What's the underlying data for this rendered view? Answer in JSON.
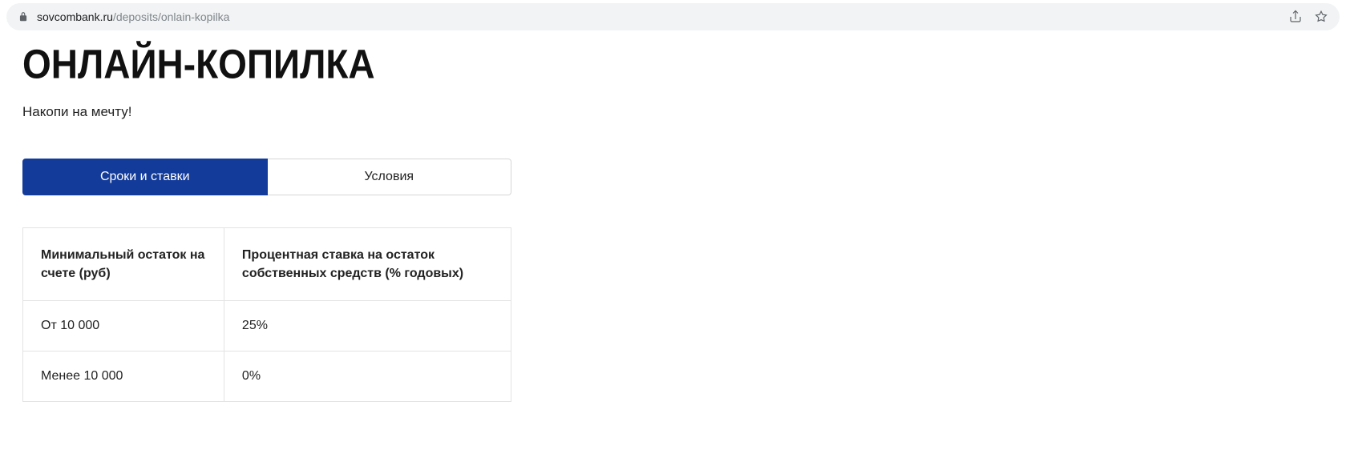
{
  "address": {
    "domain": "sovcombank.ru",
    "path": "/deposits/onlain-kopilka"
  },
  "page": {
    "title": "ОНЛАЙН-КОПИЛКА",
    "subtitle": "Накопи на мечту!"
  },
  "tabs": [
    {
      "label": "Сроки и ставки",
      "active": true
    },
    {
      "label": "Условия",
      "active": false
    }
  ],
  "table": {
    "headers": [
      "Минимальный остаток на счете (руб)",
      "Процентная ставка на остаток собственных средств (% годовых)"
    ],
    "rows": [
      [
        "От 10 000",
        "25%"
      ],
      [
        "Менее 10 000",
        "0%"
      ]
    ]
  }
}
